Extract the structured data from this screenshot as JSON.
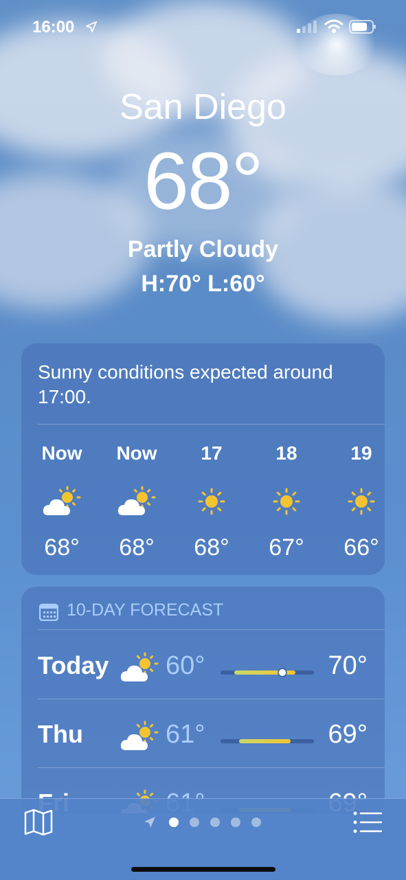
{
  "status_bar": {
    "time": "16:00"
  },
  "location": {
    "city": "San Diego",
    "temperature": "68°",
    "condition": "Partly Cloudy",
    "high_low": "H:70°  L:60°"
  },
  "hourly": {
    "summary": "Sunny conditions expected around 17:00.",
    "items": [
      {
        "label": "Now",
        "icon": "partly-cloudy-icon",
        "temp": "68°"
      },
      {
        "label": "Now",
        "icon": "partly-cloudy-icon",
        "temp": "68°"
      },
      {
        "label": "17",
        "icon": "sun-icon",
        "temp": "68°"
      },
      {
        "label": "18",
        "icon": "sun-icon",
        "temp": "67°"
      },
      {
        "label": "19",
        "icon": "sun-icon",
        "temp": "66°"
      }
    ]
  },
  "forecast": {
    "title": "10-DAY FORECAST",
    "icon": "calendar-icon",
    "days": [
      {
        "day": "Today",
        "icon": "partly-cloudy-icon",
        "low": "60°",
        "high": "70°",
        "range_start": 0.15,
        "range_end": 0.8,
        "current_marker": 0.66
      },
      {
        "day": "Thu",
        "icon": "partly-cloudy-icon",
        "low": "61°",
        "high": "69°",
        "range_start": 0.2,
        "range_end": 0.75
      },
      {
        "day": "Fri",
        "icon": "partly-cloudy-icon",
        "low": "61°",
        "high": "69°",
        "range_start": 0.2,
        "range_end": 0.75
      }
    ]
  },
  "tab_bar": {
    "page_count": 5,
    "active_page": 0,
    "icons": [
      "map-icon",
      "location-arrow-icon",
      "list-icon"
    ]
  },
  "colors": {
    "accent_low_temp": "#a9cdfa",
    "bar_start": "#c9d96a",
    "bar_end": "#f2c530",
    "sun": "#f4c430"
  }
}
